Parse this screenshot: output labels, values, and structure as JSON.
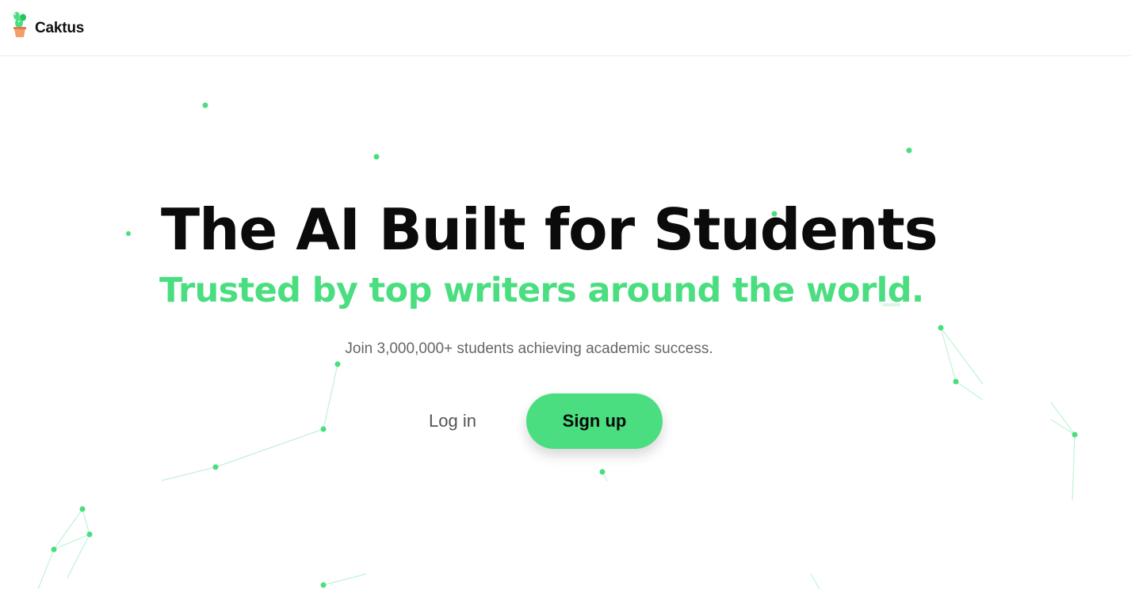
{
  "header": {
    "brand_name": "Caktus",
    "logo_icon": "cactus-pot-icon"
  },
  "hero": {
    "headline": "The AI Built for Students",
    "subheadline": "Trusted by top writers around the world.",
    "tagline": "Join 3,000,000+ students achieving academic success.",
    "login_label": "Log in",
    "signup_label": "Sign up"
  },
  "colors": {
    "accent": "#4ade80",
    "heading": "#0b0b0b",
    "muted_text": "#666666",
    "background": "#ffffff"
  }
}
